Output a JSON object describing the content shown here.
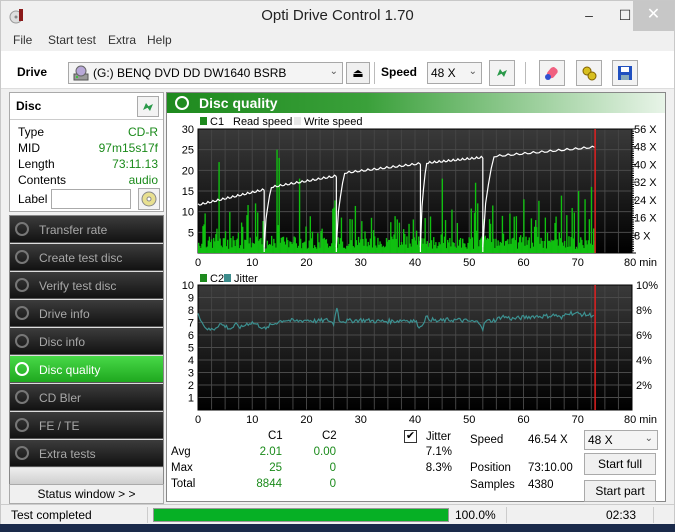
{
  "window": {
    "title": "Opti Drive Control 1.70",
    "controls": {
      "minimize": "‒",
      "maximize": "☐",
      "close": "✕"
    }
  },
  "menu": [
    "File",
    "Start test",
    "Extra",
    "Help"
  ],
  "toolbar": {
    "drive_label": "Drive",
    "drive_value": "(G:)  BENQ DVD DD DW1640 BSRB",
    "speed_label": "Speed",
    "speed_value": "48 X",
    "icons": [
      "eject-icon",
      "refresh-icon",
      "erase-icon",
      "settings-icon",
      "save-icon"
    ]
  },
  "disc": {
    "header": "Disc",
    "rows": [
      {
        "key": "Type",
        "value": "CD-R"
      },
      {
        "key": "MID",
        "value": "97m15s17f"
      },
      {
        "key": "Length",
        "value": "73:11.13"
      },
      {
        "key": "Contents",
        "value": "audio"
      }
    ],
    "label_key": "Label",
    "label_value": ""
  },
  "nav": {
    "items": [
      {
        "label": "Transfer rate",
        "active": false
      },
      {
        "label": "Create test disc",
        "active": false
      },
      {
        "label": "Verify test disc",
        "active": false
      },
      {
        "label": "Drive info",
        "active": false
      },
      {
        "label": "Disc info",
        "active": false
      },
      {
        "label": "Disc quality",
        "active": true
      },
      {
        "label": "CD Bler",
        "active": false
      },
      {
        "label": "FE / TE",
        "active": false
      },
      {
        "label": "Extra tests",
        "active": false
      }
    ],
    "status_window": "Status window > >"
  },
  "panel": {
    "title": "Disc quality"
  },
  "chart_data": [
    {
      "type": "bar",
      "title": "C1 / Read speed",
      "legend": [
        "C1",
        "Read speed",
        "Write speed"
      ],
      "legend_colors": {
        "C1": "#1e8a1e",
        "Read speed": "#ffffff",
        "Write speed": "#e8e8e8"
      },
      "xlabel": "min",
      "x_ticks": [
        0,
        10,
        20,
        30,
        40,
        50,
        60,
        70,
        80
      ],
      "xlim": [
        0,
        80
      ],
      "ylim": [
        0,
        30
      ],
      "y_ticks": [
        5,
        10,
        15,
        20,
        25,
        30
      ],
      "y2_ticks": [
        "8 X",
        "16 X",
        "24 X",
        "32 X",
        "40 X",
        "48 X",
        "56 X"
      ],
      "y2lim": [
        0,
        56
      ],
      "end_marker_min": 73.2,
      "c1_peaks": [
        {
          "x": 3.8,
          "y": 22
        },
        {
          "x": 14.4,
          "y": 25
        },
        {
          "x": 14.9,
          "y": 23
        },
        {
          "x": 18.5,
          "y": 18
        },
        {
          "x": 10.5,
          "y": 12
        },
        {
          "x": 45,
          "y": 18
        },
        {
          "x": 51,
          "y": 17
        },
        {
          "x": 60,
          "y": 13
        },
        {
          "x": 70,
          "y": 15
        },
        {
          "x": 72.5,
          "y": 16
        }
      ],
      "c1_avg": 2.01,
      "speed_segments": [
        {
          "x": [
            0,
            12.2
          ],
          "y": [
            11.5,
            15.2
          ]
        },
        {
          "x": [
            12.2,
            25.5
          ],
          "y": [
            15.5,
            18.5
          ]
        },
        {
          "x": [
            25.5,
            41
          ],
          "y": [
            19,
            21.5
          ]
        },
        {
          "x": [
            41,
            52.5
          ],
          "y": [
            21.5,
            23
          ]
        },
        {
          "x": [
            52.5,
            73.2
          ],
          "y": [
            23,
            25.5
          ]
        }
      ],
      "speed_unit_note": "speed plotted on left scale equivalent (X = value*56/30)"
    },
    {
      "type": "line",
      "title": "C2 / Jitter",
      "legend": [
        "C2",
        "Jitter"
      ],
      "legend_colors": {
        "C2": "#1e8a1e",
        "Jitter": "#3c8c8c"
      },
      "xlabel": "min",
      "x_ticks": [
        0,
        10,
        20,
        30,
        40,
        50,
        60,
        70,
        80
      ],
      "xlim": [
        0,
        80
      ],
      "ylim": [
        0,
        10
      ],
      "y_ticks": [
        1,
        2,
        3,
        4,
        5,
        6,
        7,
        8,
        9,
        10
      ],
      "y2_ticks": [
        "2%",
        "4%",
        "6%",
        "8%",
        "10%"
      ],
      "end_marker_min": 73.2,
      "jitter_x": [
        0,
        1,
        2,
        3,
        4,
        5,
        6,
        7,
        8,
        9,
        10,
        11,
        12,
        12.5,
        13,
        14,
        15,
        16,
        18,
        20,
        22,
        24,
        25,
        25.6,
        26,
        27,
        30,
        33,
        36,
        38,
        40,
        41,
        42,
        44,
        46,
        48,
        50,
        52,
        52.5,
        53,
        55,
        56,
        58,
        60,
        62,
        64,
        66,
        67,
        68,
        70,
        72,
        73.2
      ],
      "jitter_y": [
        7.8,
        6.8,
        6.4,
        6.5,
        6.9,
        6.7,
        6.5,
        6.8,
        6.6,
        6.9,
        7.0,
        6.8,
        6.6,
        6.4,
        6.7,
        6.9,
        7.1,
        7.2,
        7.1,
        7.2,
        7.1,
        7.2,
        6.9,
        8.3,
        7.2,
        7.1,
        7.2,
        7.1,
        7.1,
        7.2,
        7.1,
        6.6,
        7.4,
        7.1,
        7.2,
        7.2,
        7.1,
        7.0,
        6.5,
        7.1,
        7.2,
        7.5,
        7.3,
        7.4,
        7.5,
        7.5,
        7.6,
        7.3,
        7.8,
        7.7,
        7.6,
        7.6
      ]
    }
  ],
  "stats": {
    "col_c1": "C1",
    "col_c2": "C2",
    "jitter_label": "Jitter",
    "jitter_checked": true,
    "rows": [
      {
        "label": "Avg",
        "c1": "2.01",
        "c2": "0.00",
        "jitter": "7.1%"
      },
      {
        "label": "Max",
        "c1": "25",
        "c2": "0",
        "jitter": "8.3%"
      },
      {
        "label": "Total",
        "c1": "8844",
        "c2": "0",
        "jitter": ""
      }
    ],
    "speed_label": "Speed",
    "speed_value": "46.54 X",
    "position_label": "Position",
    "position_value": "73:10.00",
    "samples_label": "Samples",
    "samples_value": "4380",
    "speed_select": "48 X",
    "start_full": "Start full",
    "start_part": "Start part"
  },
  "statusbar": {
    "text": "Test completed",
    "progress": 1.0,
    "progress_text": "100.0%",
    "time": "02:33"
  }
}
